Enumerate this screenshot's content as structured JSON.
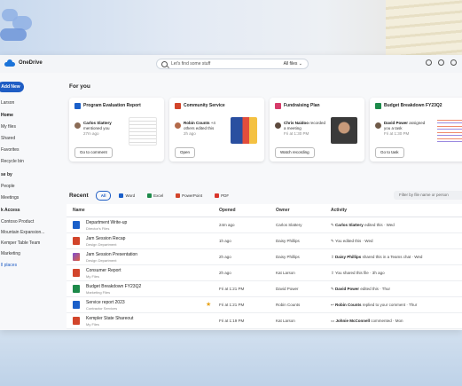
{
  "colors": {
    "accent": "#1f5dc4",
    "word": "#1a5fc9",
    "excel": "#1d8a4a",
    "powerpoint": "#d2452b",
    "pdf": "#d9362b",
    "loop": "#7a4fd6"
  },
  "app": {
    "name": "OneDrive"
  },
  "search": {
    "placeholder": "Let's find some stuff",
    "filter": "All files"
  },
  "topbar_icons": [
    "bell-icon",
    "gear-icon",
    "help-icon"
  ],
  "sidebar": {
    "add_new": "Add New",
    "sections": [
      {
        "label": "Larson"
      },
      {
        "label": "Home"
      },
      {
        "label": "My files"
      },
      {
        "label": "Shared"
      },
      {
        "label": "Favorites"
      },
      {
        "label": "Recycle bin"
      },
      {
        "label": "se by"
      },
      {
        "label": "People"
      },
      {
        "label": "Meetings"
      },
      {
        "label": "k Access"
      },
      {
        "label": "Contoso Product"
      },
      {
        "label": "Mountain Expansion..."
      },
      {
        "label": "Kemper Table Team"
      },
      {
        "label": "Marketing"
      },
      {
        "label": "ll places"
      }
    ]
  },
  "for_you": {
    "title": "For you",
    "cards": [
      {
        "title": "Program Evaluation Report",
        "person": "Carlos Slattery",
        "action": "mentioned you",
        "time": "27m ago",
        "button": "Go to comment",
        "icon": "word-icon"
      },
      {
        "title": "Community Service",
        "person": "Robin Counts",
        "action": "+4 others edited this",
        "time": "2h ago",
        "button": "Open",
        "icon": "powerpoint-icon"
      },
      {
        "title": "Fundraising Plan",
        "person": "Chris Naidoo",
        "action": "recorded a meeting",
        "time": "Fri at 1:30 PM",
        "button": "Watch recording",
        "icon": "stream-icon"
      },
      {
        "title": "Budget Breakdown FY23Q2",
        "person": "David Power",
        "action": "assigned you a task",
        "time": "Fri at 1:30 PM",
        "button": "Go to task",
        "icon": "excel-icon"
      }
    ]
  },
  "recent": {
    "title": "Recent",
    "filters": [
      "All",
      "Word",
      "Excel",
      "PowerPoint",
      "PDF"
    ],
    "filter_placeholder": "Filter by file name or person",
    "columns": [
      "Name",
      "Opened",
      "Owner",
      "Activity"
    ],
    "rows": [
      {
        "name": "Department Write-up",
        "location": "Director's Files",
        "opened": "24m ago",
        "owner": "Carlos Slattery",
        "actor": "Carlos Slattery",
        "activity": "edited this · Wed",
        "type": "word"
      },
      {
        "name": "Jam Session Recap",
        "location": "Design Department",
        "opened": "1h ago",
        "owner": "Daisy Phillips",
        "actor": "",
        "activity": "You edited this · Wed",
        "type": "powerpoint"
      },
      {
        "name": "Jam Session Presentation",
        "location": "Design Department",
        "opened": "2h ago",
        "owner": "Daisy Phillips",
        "actor": "Daisy Phillips",
        "activity": "shared this in a Teams chat · Wed",
        "type": "loop"
      },
      {
        "name": "Consumer Report",
        "location": "My Files",
        "opened": "2h ago",
        "owner": "Kat Larson",
        "actor": "",
        "activity": "You shared this file · 3h ago",
        "type": "powerpoint"
      },
      {
        "name": "Budget Breakdown FY23Q2",
        "location": "Marketing Files",
        "opened": "Fri at 1:21 PM",
        "owner": "David Power",
        "actor": "David Power",
        "activity": "edited this · Thur",
        "type": "excel"
      },
      {
        "name": "Service report 2023",
        "location": "Contractor Services",
        "opened": "Fri at 1:21 PM",
        "owner": "Robin Counts",
        "actor": "Robin Counts",
        "activity": "replied to your comment · Thur",
        "type": "word",
        "starred": true
      },
      {
        "name": "Kempler State Shareout",
        "location": "My Files",
        "opened": "Fri at 1:19 PM",
        "owner": "Kat Larson",
        "actor": "Johnie McConnell",
        "activity": "commented · Mon",
        "type": "powerpoint"
      }
    ]
  }
}
